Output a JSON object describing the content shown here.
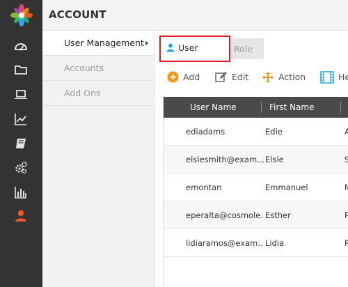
{
  "header": {
    "title": "ACCOUNT"
  },
  "rail": {
    "icons": [
      "dashboard-icon",
      "folder-icon",
      "laptop-icon",
      "trend-chart-icon",
      "book-icon",
      "gears-icon",
      "bar-chart-icon",
      "user-icon"
    ],
    "active_color": "#f15a24"
  },
  "submenu": {
    "items": [
      {
        "label": "User Management"
      },
      {
        "label": "Accounts"
      },
      {
        "label": "Add Ons"
      }
    ]
  },
  "tabs": {
    "user": "User",
    "role": "Role",
    "user_icon_color": "#29a9e0"
  },
  "toolbar": {
    "add": "Add",
    "edit": "Edit",
    "action": "Action",
    "help": "Help"
  },
  "table": {
    "columns": [
      "User Name",
      "First Name"
    ],
    "rows": [
      {
        "user_name": "ediadams",
        "first_name": "Edie",
        "third": "A"
      },
      {
        "user_name": "elsiesmith@exam…",
        "first_name": "Elsie",
        "third": "S"
      },
      {
        "user_name": "emontan",
        "first_name": "Emmanuel",
        "third": "M"
      },
      {
        "user_name": "eperalta@cosmole…",
        "first_name": "Esther",
        "third": "P"
      },
      {
        "user_name": "lidiaramos@exam…",
        "first_name": "Lidia",
        "third": "R"
      }
    ]
  }
}
